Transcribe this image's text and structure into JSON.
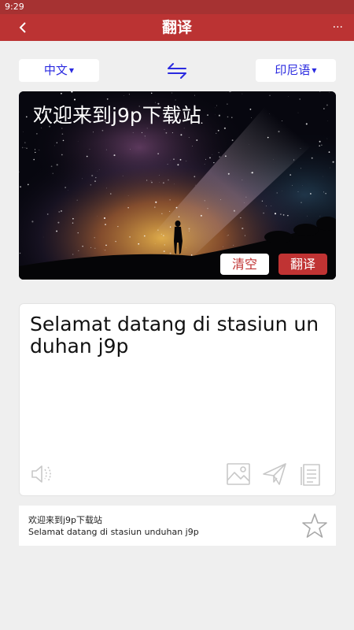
{
  "status_bar": {
    "time": "9:29"
  },
  "header": {
    "title": "翻译",
    "back_icon": "chevron-left-icon",
    "more_label": "···"
  },
  "languages": {
    "source": "中文",
    "target": "印尼语",
    "swap_icon": "swap-arrows-icon"
  },
  "input": {
    "text": "欢迎来到j9p下载站",
    "clear_label": "清空",
    "translate_label": "翻译"
  },
  "output": {
    "text": "Selamat datang di stasiun unduhan j9p",
    "icons": [
      "speaker-icon",
      "image-icon",
      "send-icon",
      "copy-icon"
    ]
  },
  "history": {
    "source": "欢迎来到j9p下载站",
    "translation": "Selamat datang di stasiun unduhan j9p",
    "favorite_icon": "star-icon"
  },
  "colors": {
    "brand_red": "#bb3333",
    "lang_blue": "#2a2ae0",
    "icon_grey": "#c8c8c8"
  }
}
